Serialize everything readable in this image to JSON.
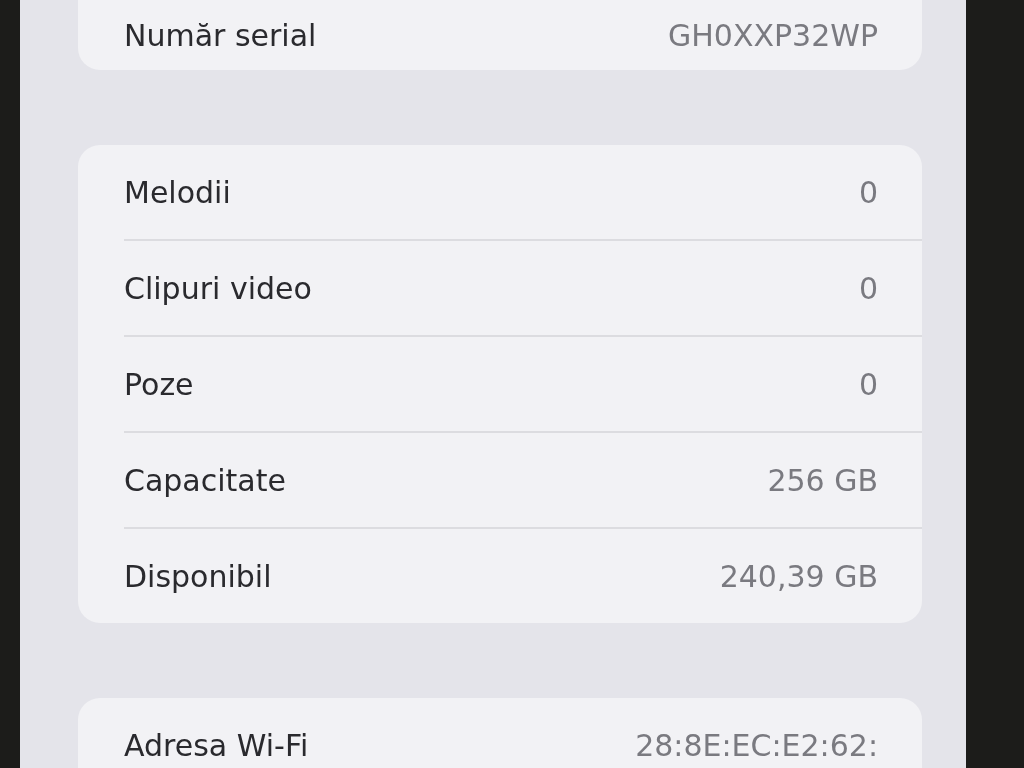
{
  "groups": [
    {
      "rows": [
        {
          "label": "Număr serial",
          "value": "GH0XXP32WP"
        }
      ]
    },
    {
      "rows": [
        {
          "label": "Melodii",
          "value": "0"
        },
        {
          "label": "Clipuri video",
          "value": "0"
        },
        {
          "label": "Poze",
          "value": "0"
        },
        {
          "label": "Capacitate",
          "value": "256 GB"
        },
        {
          "label": "Disponibil",
          "value": "240,39 GB"
        }
      ]
    },
    {
      "rows": [
        {
          "label": "Adresa Wi-Fi",
          "value": "28:8E:EC:E2:62:"
        }
      ]
    }
  ]
}
